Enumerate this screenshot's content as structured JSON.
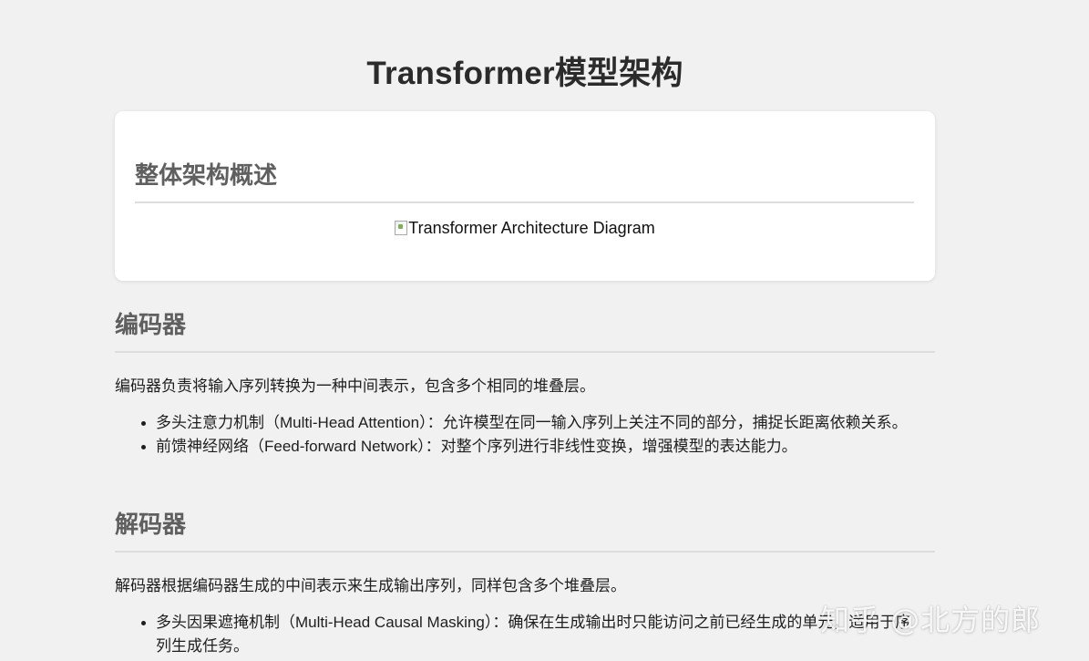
{
  "page": {
    "title": "Transformer模型架构"
  },
  "overview": {
    "heading": "整体架构概述",
    "image_alt": "Transformer Architecture Diagram"
  },
  "encoder": {
    "heading": "编码器",
    "description": "编码器负责将输入序列转换为一种中间表示，包含多个相同的堆叠层。",
    "items": [
      "多头注意力机制（Multi-Head Attention）：允许模型在同一输入序列上关注不同的部分，捕捉长距离依赖关系。",
      "前馈神经网络（Feed-forward Network）：对整个序列进行非线性变换，增强模型的表达能力。"
    ]
  },
  "decoder": {
    "heading": "解码器",
    "description": "解码器根据编码器生成的中间表示来生成输出序列，同样包含多个堆叠层。",
    "items": [
      "多头因果遮掩机制（Multi-Head Causal Masking）：确保在生成输出时只能访问之前已经生成的单元，适用于序列生成任务。"
    ]
  },
  "watermark": {
    "text": "知乎 @北方的郎"
  },
  "colors": {
    "background": "#f1f1f1",
    "card": "#ffffff",
    "heading_gray": "#5f5f5f",
    "divider": "#dddddd"
  }
}
